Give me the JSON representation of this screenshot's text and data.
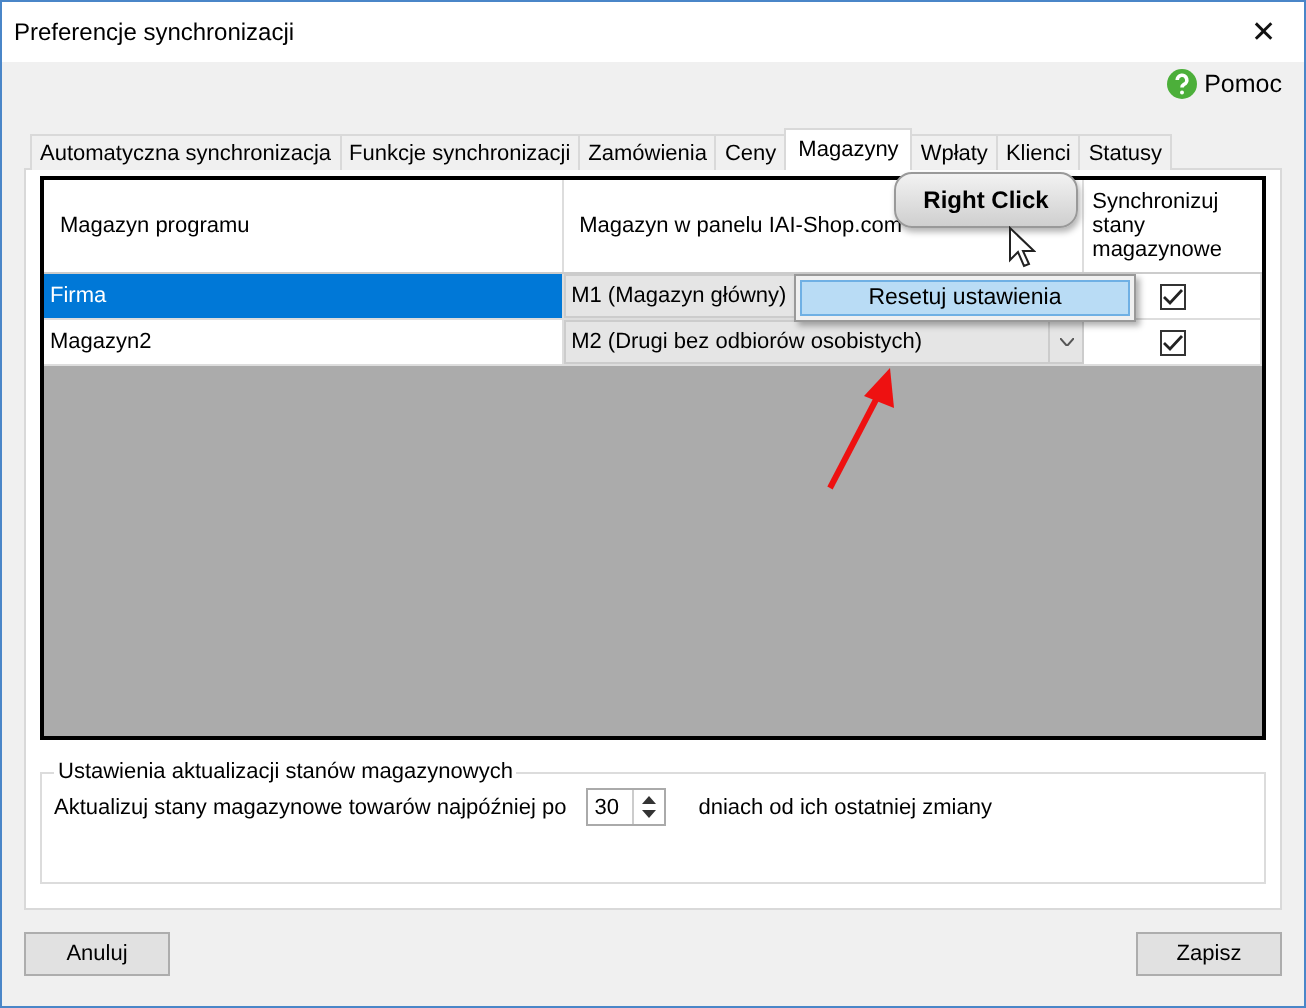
{
  "window": {
    "title": "Preferencje synchronizacji",
    "close": "✕"
  },
  "help": {
    "label": "Pomoc"
  },
  "tabs": [
    {
      "label": "Automatyczna synchronizacja",
      "selected": false
    },
    {
      "label": "Funkcje synchronizacji",
      "selected": false
    },
    {
      "label": "Zamówienia",
      "selected": false
    },
    {
      "label": "Ceny",
      "selected": false
    },
    {
      "label": "Magazyny",
      "selected": true
    },
    {
      "label": "Wpłaty",
      "selected": false
    },
    {
      "label": "Klienci",
      "selected": false
    },
    {
      "label": "Statusy",
      "selected": false
    }
  ],
  "table": {
    "columns": [
      "Magazyn programu",
      "Magazyn w panelu IAI-Shop.com",
      "Synchronizuj stany magazynowe"
    ],
    "rows": [
      {
        "name": "Firma",
        "warehouse": "M1 (Magazyn główny)",
        "checked": true,
        "selected": true
      },
      {
        "name": "Magazyn2",
        "warehouse": "M2 (Drugi bez odbiorów osobistych)",
        "checked": true,
        "selected": false
      }
    ]
  },
  "callout": {
    "label": "Right Click"
  },
  "context_menu": {
    "items": [
      "Resetuj ustawienia"
    ]
  },
  "group": {
    "title": "Ustawienia aktualizacji stanów magazynowych",
    "label_before": "Aktualizuj stany magazynowe towarów najpóźniej po",
    "value": "30",
    "label_after": "dniach od ich ostatniej zmiany"
  },
  "buttons": [
    {
      "label": "Anuluj"
    },
    {
      "label": "Zapisz"
    }
  ]
}
